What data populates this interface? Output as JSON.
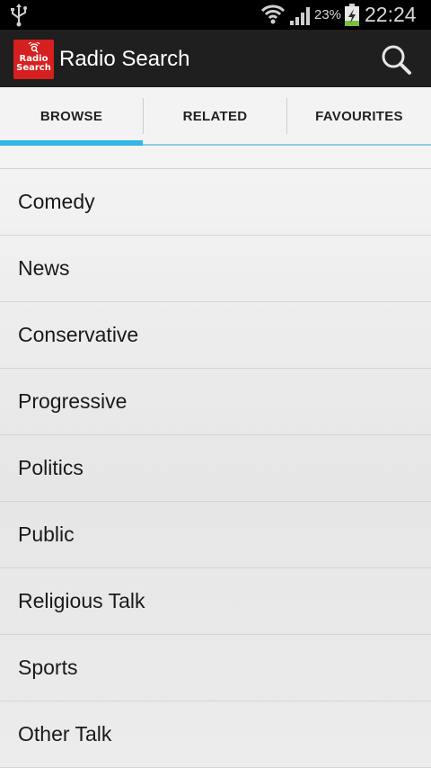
{
  "status_bar": {
    "battery_percent": "23%",
    "time": "22:24",
    "icons": [
      "usb-icon",
      "wifi-icon",
      "signal-icon",
      "battery-charging-icon"
    ]
  },
  "action_bar": {
    "logo_text": "Radio\nSearch",
    "title": "Radio Search",
    "search_icon": "search-icon"
  },
  "tabs": [
    {
      "label": "BROWSE",
      "selected": true
    },
    {
      "label": "RELATED",
      "selected": false
    },
    {
      "label": "FAVOURITES",
      "selected": false
    }
  ],
  "genres": [
    {
      "label": "Comedy"
    },
    {
      "label": "News"
    },
    {
      "label": "Conservative"
    },
    {
      "label": "Progressive"
    },
    {
      "label": "Politics"
    },
    {
      "label": "Public"
    },
    {
      "label": "Religious Talk"
    },
    {
      "label": "Sports"
    },
    {
      "label": "Other Talk"
    }
  ],
  "colors": {
    "accent": "#33b5e5",
    "action_bar": "#1f1f1f",
    "logo": "#d61f1f"
  }
}
